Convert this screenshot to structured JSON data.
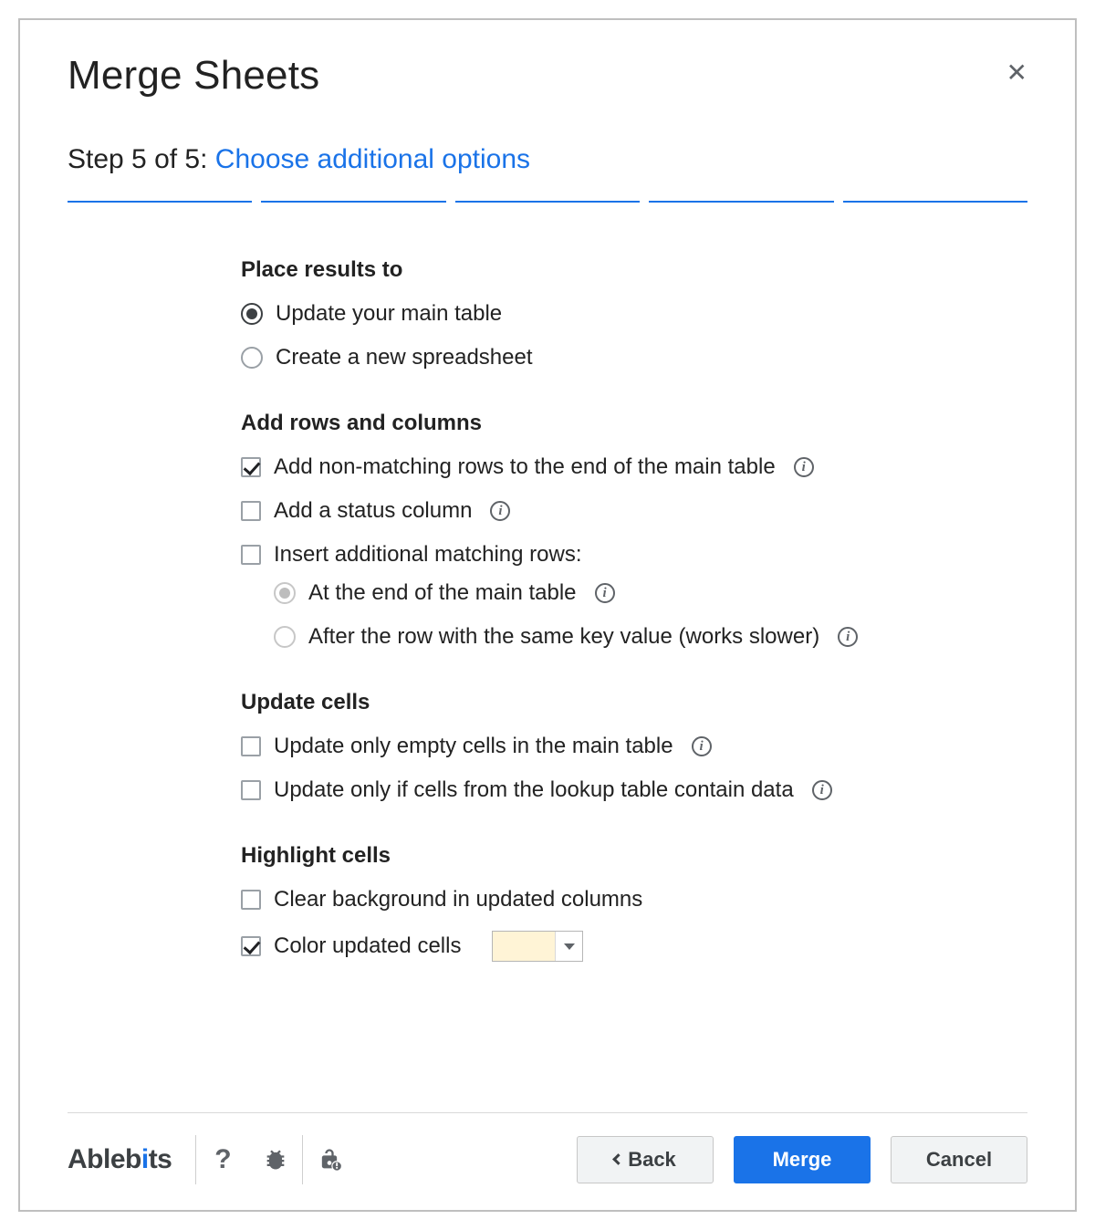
{
  "title": "Merge Sheets",
  "step_prefix": "Step 5 of 5: ",
  "step_desc": "Choose additional options",
  "progress_segments": 5,
  "sections": {
    "place_results": {
      "head": "Place results to",
      "opt_update": "Update your main table",
      "opt_create": "Create a new spreadsheet"
    },
    "add_rows_cols": {
      "head": "Add rows and columns",
      "opt_nonmatching": "Add non-matching rows to the end of the main table",
      "opt_status": "Add a status column",
      "opt_insert_additional": "Insert additional matching rows:",
      "sub_end": "At the end of the main table",
      "sub_after": "After the row with the same key value (works slower)"
    },
    "update_cells": {
      "head": "Update cells",
      "opt_empty": "Update only empty cells in the main table",
      "opt_lookup": "Update only if cells from the lookup table contain data"
    },
    "highlight": {
      "head": "Highlight cells",
      "opt_clear_bg": "Clear background in updated columns",
      "opt_color_updated": "Color updated cells",
      "swatch_color": "#fff4d6"
    }
  },
  "footer": {
    "brand_a": "Ableb",
    "brand_b": "i",
    "brand_c": "ts",
    "help_glyph": "?",
    "back": "Back",
    "merge": "Merge",
    "cancel": "Cancel"
  },
  "info_glyph": "i"
}
